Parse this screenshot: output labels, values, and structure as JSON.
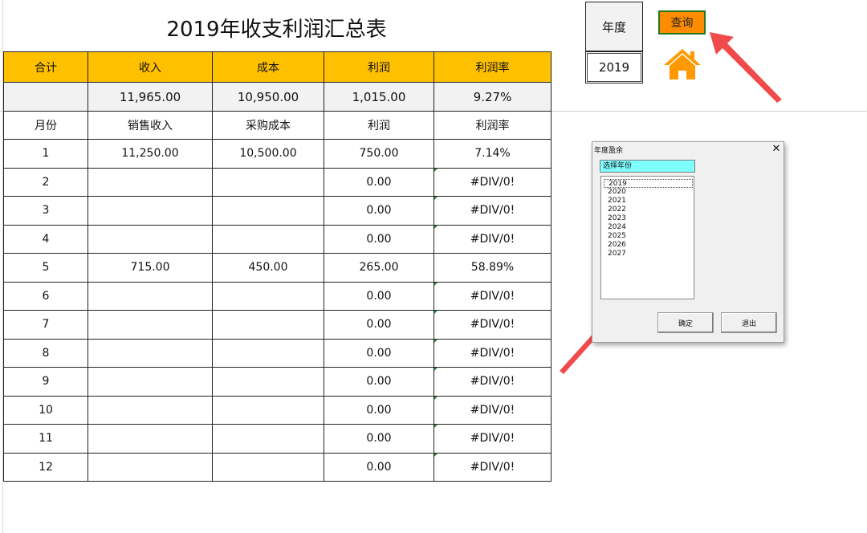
{
  "sheet": {
    "title": "2019年收支利润汇总表",
    "headers": [
      "合计",
      "收入",
      "成本",
      "利润",
      "利润率"
    ],
    "totals": [
      "",
      "11,965.00",
      "10,950.00",
      "1,015.00",
      "9.27%"
    ],
    "subheaders": [
      "月份",
      "销售收入",
      "采购成本",
      "利润",
      "利润率"
    ],
    "rows": [
      [
        "1",
        "11,250.00",
        "10,500.00",
        "750.00",
        "7.14%"
      ],
      [
        "2",
        "",
        "",
        "0.00",
        "#DIV/0!"
      ],
      [
        "3",
        "",
        "",
        "0.00",
        "#DIV/0!"
      ],
      [
        "4",
        "",
        "",
        "0.00",
        "#DIV/0!"
      ],
      [
        "5",
        "715.00",
        "450.00",
        "265.00",
        "58.89%"
      ],
      [
        "6",
        "",
        "",
        "0.00",
        "#DIV/0!"
      ],
      [
        "7",
        "",
        "",
        "0.00",
        "#DIV/0!"
      ],
      [
        "8",
        "",
        "",
        "0.00",
        "#DIV/0!"
      ],
      [
        "9",
        "",
        "",
        "0.00",
        "#DIV/0!"
      ],
      [
        "10",
        "",
        "",
        "0.00",
        "#DIV/0!"
      ],
      [
        "11",
        "",
        "",
        "0.00",
        "#DIV/0!"
      ],
      [
        "12",
        "",
        "",
        "0.00",
        "#DIV/0!"
      ]
    ]
  },
  "year_panel": {
    "label": "年度",
    "value": "2019"
  },
  "query_button": {
    "label": "查询"
  },
  "home_icon": "home-icon",
  "dialog": {
    "title": "年度盈余",
    "close": "✕",
    "select_label": "选择年份",
    "years": [
      "2019",
      "2020",
      "2021",
      "2022",
      "2023",
      "2024",
      "2025",
      "2026",
      "2027"
    ],
    "selected": "2019",
    "ok_label": "确定",
    "exit_label": "退出"
  },
  "colors": {
    "header_fill": "#ffc000",
    "query_button": "#ff8c00",
    "home": "#ff9900",
    "arrow": "#f04a4a",
    "select_label_fill": "#80ffff"
  }
}
